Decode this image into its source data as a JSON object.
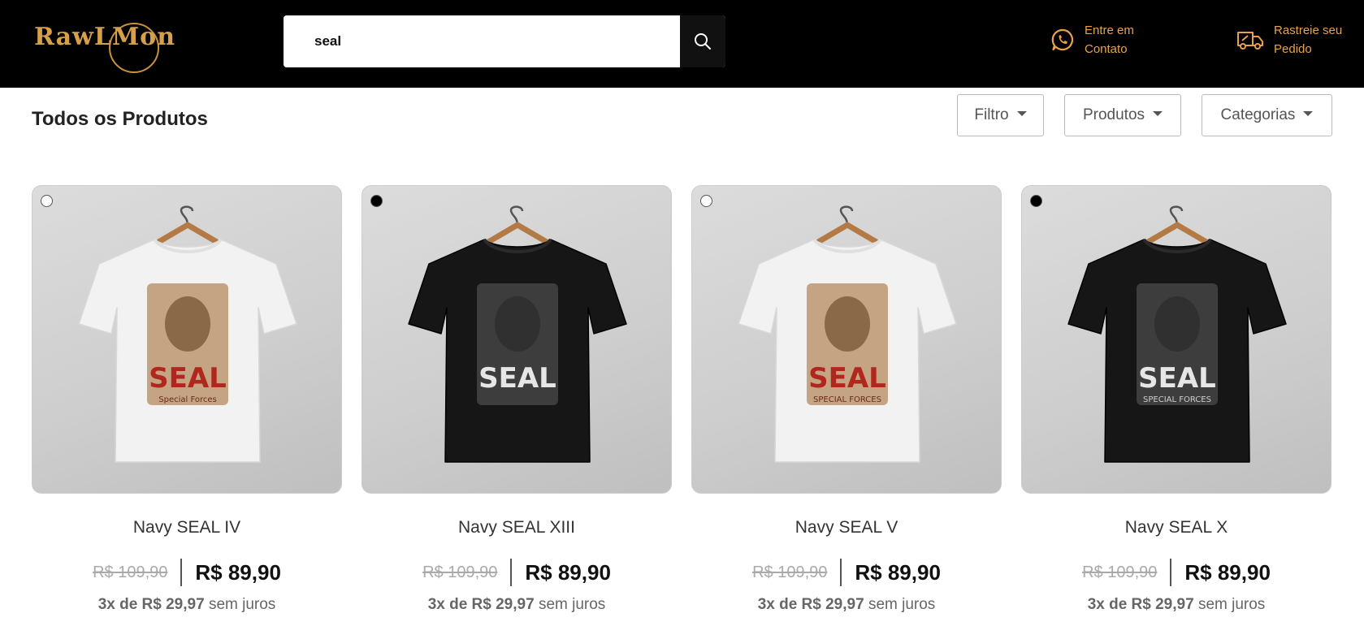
{
  "header": {
    "logo_text": "RawLMon",
    "search_value": "seal",
    "contact_line1": "Entre em",
    "contact_line2": "Contato",
    "track_line1": "Rastreie seu",
    "track_line2": "Pedido",
    "icons": {
      "search": "search-icon",
      "contact": "whatsapp-icon",
      "track": "truck-icon"
    },
    "colors": {
      "background": "#000000",
      "accent": "#e9a24a"
    }
  },
  "toolbar": {
    "title": "Todos os Produtos",
    "filtro_label": "Filtro",
    "produtos_label": "Produtos",
    "categorias_label": "Categorias"
  },
  "products": [
    {
      "name": "Navy SEAL IV",
      "old_price": "R$ 109,90",
      "price": "R$ 89,90",
      "installment_bold": "3x de R$ 29,97",
      "installment_rest": "sem juros",
      "shirt_color": "#f2f2f2",
      "print_text": "SEAL",
      "print_sub": "Special Forces"
    },
    {
      "name": "Navy SEAL XIII",
      "old_price": "R$ 109,90",
      "price": "R$ 89,90",
      "installment_bold": "3x de R$ 29,97",
      "installment_rest": "sem juros",
      "shirt_color": "#161616",
      "print_text": "SEAL",
      "print_sub": ""
    },
    {
      "name": "Navy SEAL V",
      "old_price": "R$ 109,90",
      "price": "R$ 89,90",
      "installment_bold": "3x de R$ 29,97",
      "installment_rest": "sem juros",
      "shirt_color": "#f2f2f2",
      "print_text": "SEAL",
      "print_sub": "SPECIAL FORCES"
    },
    {
      "name": "Navy SEAL X",
      "old_price": "R$ 109,90",
      "price": "R$ 89,90",
      "installment_bold": "3x de R$ 29,97",
      "installment_rest": "sem juros",
      "shirt_color": "#161616",
      "print_text": "SEAL",
      "print_sub": "SPECIAL FORCES"
    }
  ]
}
